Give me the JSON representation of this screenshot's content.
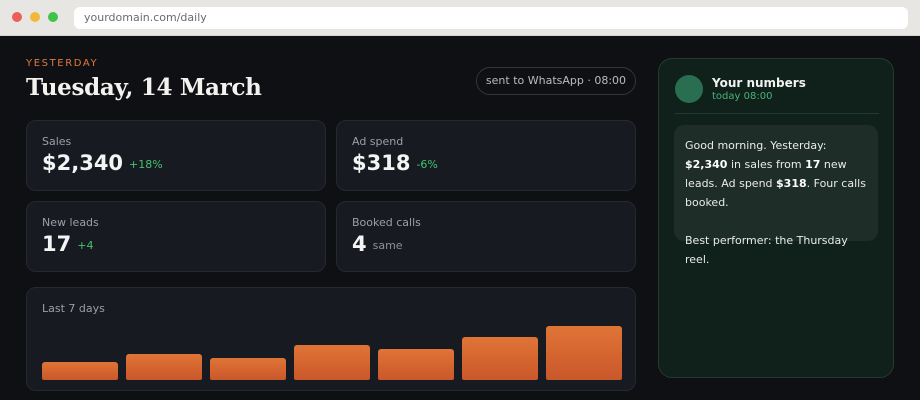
{
  "browser": {
    "url": "yourdomain.com/daily"
  },
  "header": {
    "eyebrow": "YESTERDAY",
    "title": "Tuesday, 14 March",
    "sent_status": "sent to WhatsApp · 08:00"
  },
  "metrics": {
    "sales": {
      "label": "Sales",
      "value": "$2,340",
      "delta": "+18%"
    },
    "ad_spend": {
      "label": "Ad spend",
      "value": "$318",
      "delta": "-6%"
    },
    "new_leads": {
      "label": "New leads",
      "value": "17",
      "delta": "+4"
    },
    "booked_calls": {
      "label": "Booked calls",
      "value": "4",
      "delta": "same"
    }
  },
  "week": {
    "label": "Last 7 days"
  },
  "chart_data": {
    "type": "bar",
    "values": [
      18,
      26,
      22,
      36,
      32,
      44,
      55
    ],
    "ylim": [
      0,
      55
    ],
    "title": "Last 7 days",
    "bar_color": "#d8632f"
  },
  "message": {
    "contact_name": "Your numbers",
    "contact_time": "today 08:00",
    "line1_a": "Good morning. Yesterday: ",
    "line1_sales": "$2,340",
    "line1_b": " in sales from ",
    "line1_leads": "17",
    "line1_c": " new leads. Ad spend ",
    "line1_spend": "$318",
    "line1_d": ". Four calls booked.",
    "line2": "Best performer: the Thursday reel."
  },
  "colors": {
    "accent": "#e07a3c",
    "positive": "#44c46f",
    "whatsapp_green": "#46b37b"
  }
}
